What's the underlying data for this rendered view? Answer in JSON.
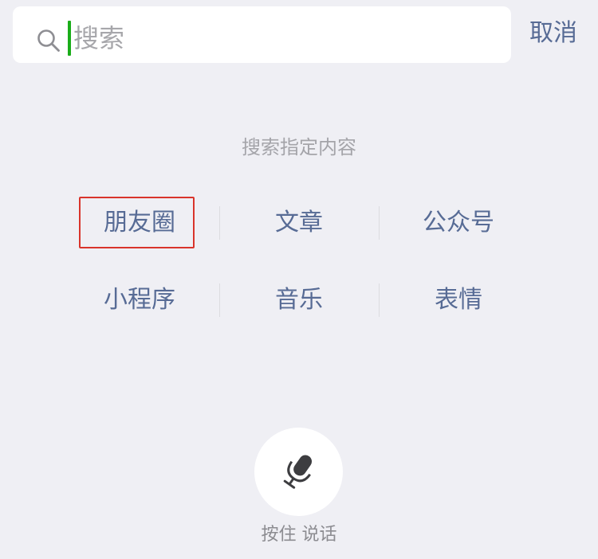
{
  "search": {
    "placeholder": "搜索",
    "value": ""
  },
  "cancel_label": "取消",
  "section_title": "搜索指定内容",
  "categories": [
    "朋友圈",
    "文章",
    "公众号",
    "小程序",
    "音乐",
    "表情"
  ],
  "highlighted_category": "朋友圈",
  "voice": {
    "icon": "microphone-icon",
    "hint": "按住 说话"
  },
  "icons": {
    "search": "search-icon",
    "microphone": "microphone-icon"
  },
  "colors": {
    "background": "#efeff4",
    "link": "#576b95",
    "caret": "#1aad19",
    "highlight": "#d9342b",
    "muted": "#a4a4a9"
  }
}
